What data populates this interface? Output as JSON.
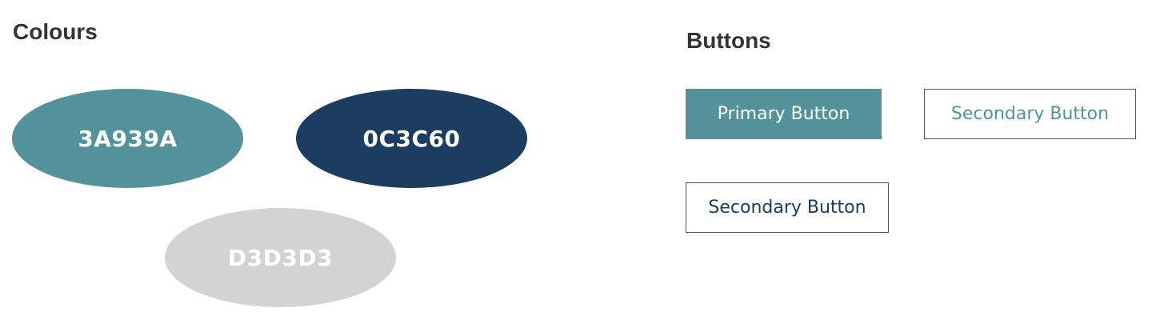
{
  "colours": {
    "heading": "Colours",
    "swatches": [
      {
        "label": "3A939A",
        "color": "#53929A",
        "text_color": "#FFFFFF"
      },
      {
        "label": "0C3C60",
        "color": "#1C3C60",
        "text_color": "#FFFFFF"
      },
      {
        "label": "D3D3D3",
        "color": "#D3D3D3",
        "text_color": "#FFFFFF"
      }
    ]
  },
  "buttons": {
    "heading": "Buttons",
    "primary": {
      "label": "Primary Button",
      "bg_color": "#53929A",
      "text_color": "#FFFFFF"
    },
    "secondary_teal": {
      "label": "Secondary Button",
      "text_color": "#53929A",
      "border_color": "#555555"
    },
    "secondary_navy": {
      "label": "Secondary Button",
      "text_color": "#1C3C60",
      "border_color": "#555555"
    }
  }
}
